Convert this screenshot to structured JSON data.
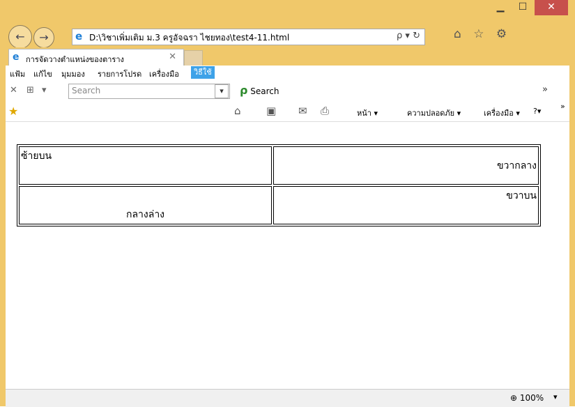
{
  "window": {
    "minimize_symbol": "▁",
    "maximize_symbol": "☐",
    "close_symbol": "✕"
  },
  "address_bar": {
    "url": "D:\\วิชาเพิ่มเติม ม.3 ครูอัจฉรา ไชยทอง\\test4-11.html",
    "search_icon": "ρ",
    "dropdown": "▾",
    "refresh_icon": "↻"
  },
  "nav": {
    "back": "←",
    "forward": "→"
  },
  "right_icons": {
    "home": "⌂",
    "favorites": "☆",
    "settings": "⚙"
  },
  "tab": {
    "title": "การจัดวางตำแหน่งของตาราง",
    "close": "✕"
  },
  "menu": {
    "file": "แฟ้ม",
    "edit": "แก้ไข",
    "view": "มุมมอง",
    "favorites": "รายการโปรด",
    "tools": "เครื่องมือ",
    "help": "วิธีใช้"
  },
  "search_toolbar": {
    "close": "✕",
    "add": "⊞",
    "dropdown": "▾",
    "placeholder": "Search",
    "search_label": "Search",
    "chevron": "»"
  },
  "command_bar": {
    "page": "หน้า ▾",
    "safety": "ความปลอดภัย ▾",
    "tools": "เครื่องมือ ▾",
    "help": "?▾",
    "chevron": "»"
  },
  "table": {
    "top_left": "ซ้ายบน",
    "middle_right": "ขวากลาง",
    "bottom_center": "กลางล่าง",
    "top_right": "ขวาบน"
  },
  "status_bar": {
    "zoom": "100%",
    "zoom_dropdown": "▾"
  }
}
